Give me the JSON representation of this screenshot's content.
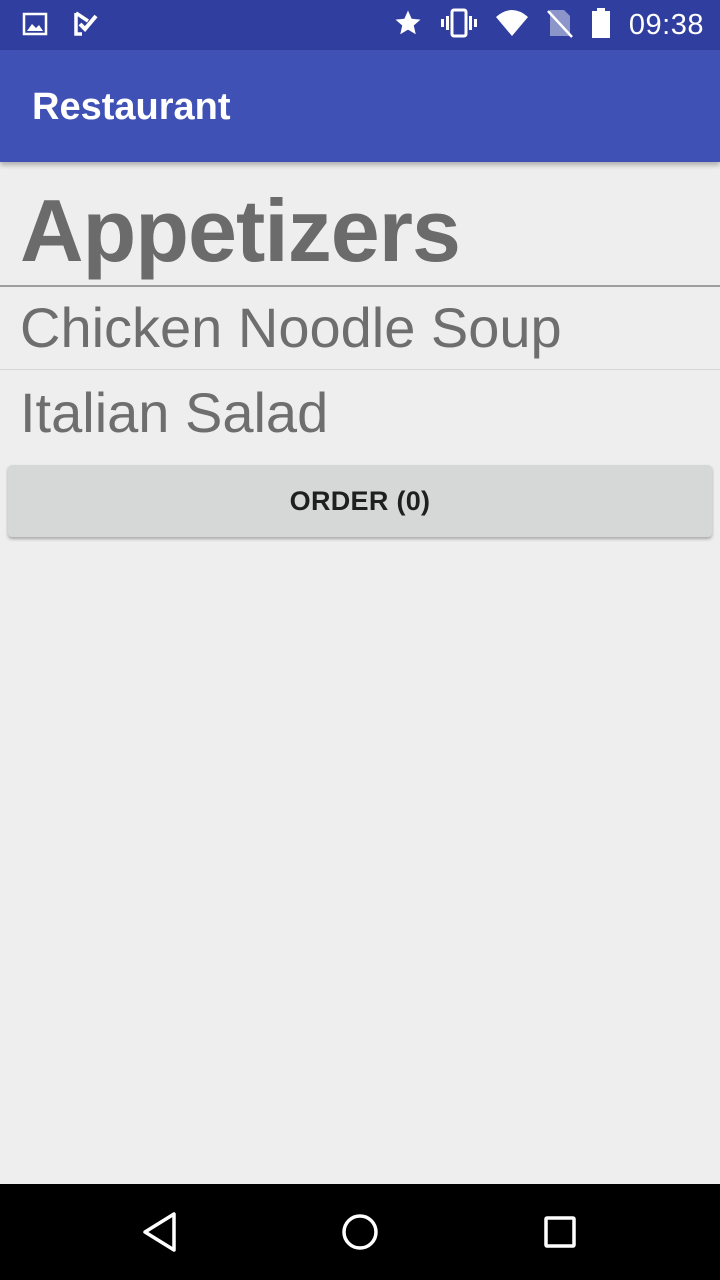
{
  "status_bar": {
    "time": "09:38",
    "left_icons": [
      "image-icon",
      "task-check-icon"
    ],
    "right_icons": [
      "star-icon",
      "vibrate-icon",
      "wifi-icon",
      "no-sim-icon",
      "battery-icon"
    ]
  },
  "app_bar": {
    "title": "Restaurant"
  },
  "menu": {
    "category": "Appetizers",
    "items": [
      {
        "label": "Chicken Noodle Soup"
      },
      {
        "label": "Italian Salad"
      }
    ]
  },
  "order_button": {
    "label": "ORDER (0)"
  },
  "nav_bar": {
    "buttons": [
      "back-icon",
      "home-icon",
      "recent-apps-icon"
    ]
  },
  "colors": {
    "status_bar": "#303f9f",
    "app_bar": "#3f51b5",
    "background": "#eeeeee",
    "button": "#d6d7d7"
  }
}
